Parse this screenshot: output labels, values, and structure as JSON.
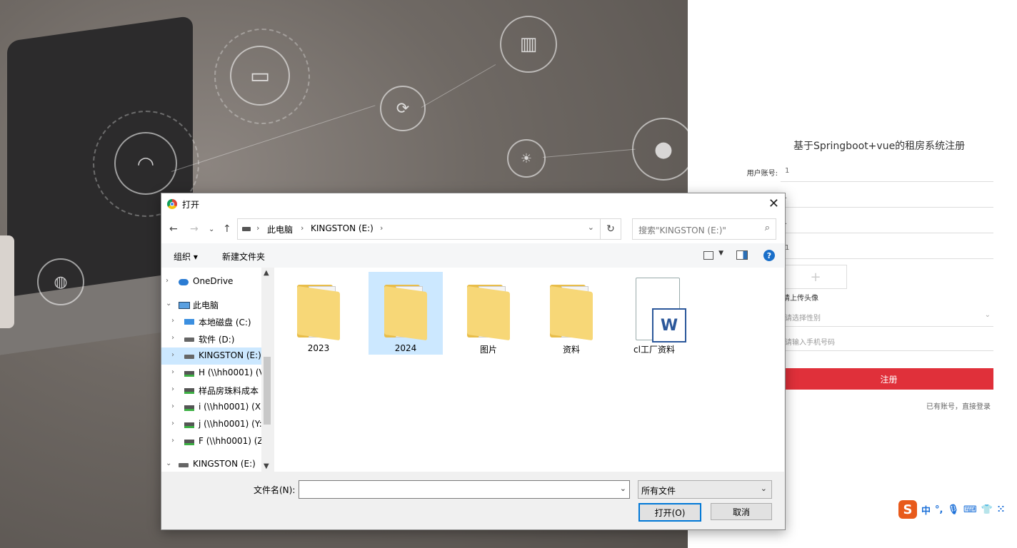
{
  "register": {
    "title": "基于Springboot+vue的租房系统注册",
    "account_label": "用户账号:",
    "account_value": "1",
    "field2_value": ".",
    "field3_value": ".",
    "field4_value": "1",
    "upload_label": "请上传头像",
    "gender_placeholder": "请选择性别",
    "phone_placeholder": "请输入手机号码",
    "submit_label": "注册",
    "login_link": "已有账号，直接登录"
  },
  "ime": {
    "logo": "S",
    "mode": "中"
  },
  "dialog": {
    "title": "打开",
    "breadcrumbs": [
      "此电脑",
      "KINGSTON (E:)"
    ],
    "search_placeholder": "搜索\"KINGSTON (E:)\"",
    "toolbar": {
      "organize": "组织",
      "new_folder": "新建文件夹"
    },
    "tree": [
      {
        "label": "OneDrive",
        "icon": "cloud-icon",
        "indent": 0,
        "expanded": false
      },
      {
        "label": "此电脑",
        "icon": "computer-icon",
        "indent": 0,
        "expanded": true
      },
      {
        "label": "本地磁盘 (C:)",
        "icon": "system-drive-icon",
        "indent": 1,
        "expanded": false
      },
      {
        "label": "软件 (D:)",
        "icon": "drive-icon",
        "indent": 1,
        "expanded": false
      },
      {
        "label": "KINGSTON (E:)",
        "icon": "drive-icon",
        "indent": 1,
        "expanded": false,
        "selected": true
      },
      {
        "label": "H (\\\\hh0001) (V",
        "icon": "network-drive-icon",
        "indent": 1,
        "expanded": false
      },
      {
        "label": "样品房珠料成本",
        "icon": "network-drive-icon",
        "indent": 1,
        "expanded": false
      },
      {
        "label": "i (\\\\hh0001) (X:",
        "icon": "network-drive-icon",
        "indent": 1,
        "expanded": false
      },
      {
        "label": "j (\\\\hh0001) (Y:",
        "icon": "network-drive-icon",
        "indent": 1,
        "expanded": false
      },
      {
        "label": "F (\\\\hh0001) (Z",
        "icon": "network-drive-icon",
        "indent": 1,
        "expanded": false
      },
      {
        "label": "KINGSTON (E:)",
        "icon": "drive-icon",
        "indent": 0,
        "expanded": true
      }
    ],
    "files": [
      {
        "name": "2023",
        "type": "folder-icon"
      },
      {
        "name": "2024",
        "type": "folder-icon",
        "selected": true
      },
      {
        "name": "图片",
        "type": "folder-icon"
      },
      {
        "name": "资料",
        "type": "folder-icon"
      },
      {
        "name": "cl工厂资料",
        "type": "word-document-icon",
        "badge": "W"
      }
    ],
    "filename_label": "文件名(N):",
    "filename_value": "",
    "filetype_value": "所有文件",
    "open_button": "打开(O)",
    "cancel_button": "取消"
  }
}
